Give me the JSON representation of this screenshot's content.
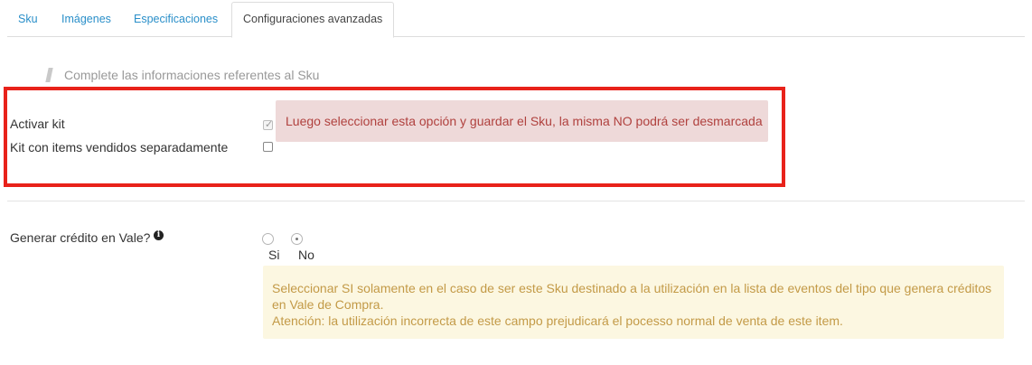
{
  "tabs": [
    {
      "label": "Sku",
      "active": false
    },
    {
      "label": "Imágenes",
      "active": false
    },
    {
      "label": "Especificaciones",
      "active": false
    },
    {
      "label": "Configuraciones avanzadas",
      "active": true
    }
  ],
  "section": {
    "hint": "Complete las informaciones referentes al Sku"
  },
  "kit": {
    "activar_label": "Activar kit",
    "activar_checked": true,
    "activar_disabled": true,
    "separado_label": "Kit con items vendidos separadamente",
    "separado_checked": false,
    "warning": "Luego seleccionar esta opción y guardar el Sku, la misma NO podrá ser desmarcada"
  },
  "credito": {
    "label": "Generar crédito en Vale?",
    "info_icon": "info-icon",
    "options": [
      {
        "label": "Si",
        "selected": false
      },
      {
        "label": "No",
        "selected": true
      }
    ],
    "notice_line1": "Seleccionar SI solamente en el caso de ser este Sku destinado a la utilización en la lista de eventos del tipo que genera créditos",
    "notice_line2": "en Vale de Compra.",
    "notice_line3": "Atención: la utilización incorrecta de este campo prejudicará el pocesso normal de venta de este item."
  },
  "colors": {
    "link": "#2a8fc9",
    "highlight_border": "#e8221a",
    "danger_bg": "#eed9d9",
    "danger_text": "#b0413e",
    "warning_bg": "#fcf7e1",
    "warning_text": "#c39a47"
  }
}
